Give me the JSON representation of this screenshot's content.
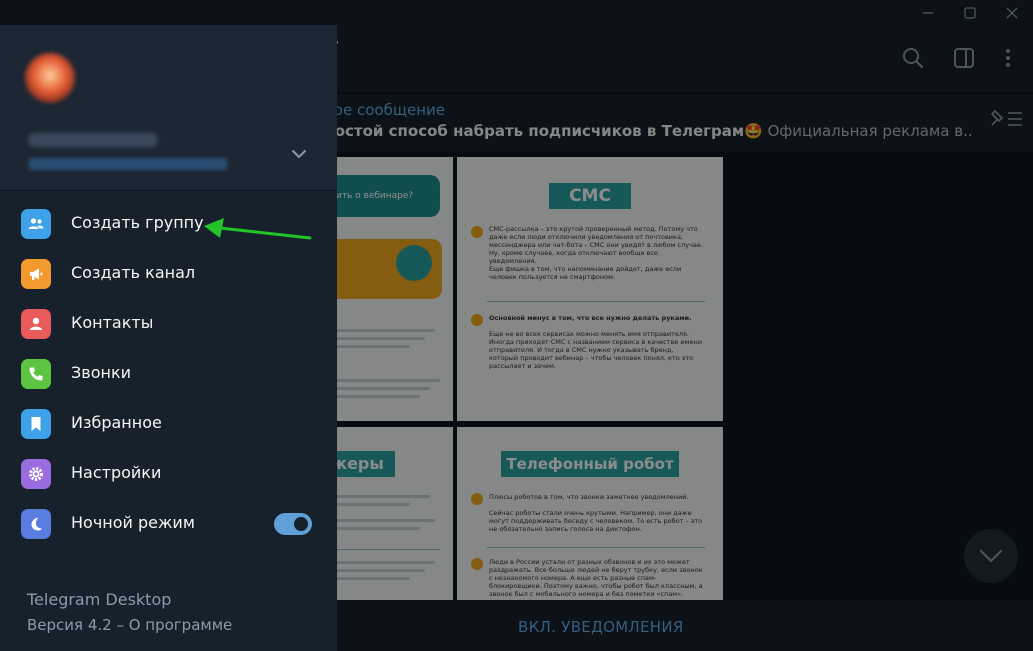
{
  "chat": {
    "title_partial": "r",
    "pinned_label": "ное сообщение",
    "pinned_title": "ростой способ набрать подписчиков в Телеграм",
    "pinned_emoji": "🤩",
    "pinned_rest": "Официальная реклама в...",
    "bottom_button": "ВКЛ. УВЕДОМЛЕНИЯ"
  },
  "tiles": {
    "t1_bubble": "нить о вебинаре?",
    "t2_heading": "СМС",
    "t2_p1": "СМС-рассылка – это крутой проверенный метод. Потому что даже если люди отключили уведомления от почтовика, мессенджера или чат-бота – СМС они увидят в любом случае. Ну, кроме случаев, когда отключают вообще все уведомления.",
    "t2_p2": "Еще фишка в том, что напоминание дойдет, даже если человек пользуется не смартфоном.",
    "t2_p3": "Основной минус в том, что все нужно делать руками.",
    "t2_p4": "Еще не во всех сервисах можно менять имя отправителя. Иногда приходят СМС с названием сервиса в качестве имени отправителя. И тогда в СМС нужно указывать бренд, который проводит вебинар – чтобы человек понял, кто это рассылает и зачем.",
    "t3_heading": "жеры",
    "t4_heading": "Телефонный робот",
    "t4_p1": "Плюсы роботов в том, что звонки заметнее уведомлений.",
    "t4_p2": "Сейчас роботы стали очень крутыми. Например, они даже могут поддерживать беседу с человеком. То есть робот – это не обязательно запись голоса на диктофон.",
    "t4_p3": "Люди в России устали от разных обзвонов и их это может раздражать. Все больше людей не берут трубку, если звонок с незнакомого номера. А еще есть разные спам-блокировщики. Поэтому важно, чтобы робот был классным, а звонок был с мобильного номера и без пометки «спам»."
  },
  "drawer": {
    "menu": [
      {
        "label": "Создать группу",
        "icon": "group-icon",
        "color": "#3fa2e8"
      },
      {
        "label": "Создать канал",
        "icon": "megaphone-icon",
        "color": "#f29a2e"
      },
      {
        "label": "Контакты",
        "icon": "person-icon",
        "color": "#e95a5a"
      },
      {
        "label": "Звонки",
        "icon": "phone-icon",
        "color": "#5cc440"
      },
      {
        "label": "Избранное",
        "icon": "bookmark-icon",
        "color": "#3fa2e8"
      },
      {
        "label": "Настройки",
        "icon": "gear-icon",
        "color": "#9a6ce0"
      },
      {
        "label": "Ночной режим",
        "icon": "moon-icon",
        "color": "#5a7de0"
      }
    ],
    "night_mode_on": true,
    "app_name": "Telegram Desktop",
    "app_version": "Версия 4.2 – О программе"
  },
  "colors": {
    "accent": "#5fa0d9",
    "annotation_arrow": "#21c22a"
  }
}
